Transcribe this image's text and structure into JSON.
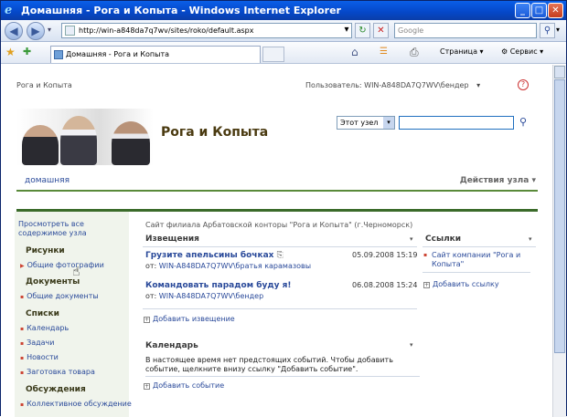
{
  "window": {
    "title": "Домашняя - Рога и Копыта - Windows Internet Explorer",
    "ie_glyph": "e",
    "min": "_",
    "max": "□",
    "close": "✕"
  },
  "nav": {
    "back_icon": "back-arrow-icon",
    "fwd_icon": "forward-arrow-icon",
    "address": "http://win-a848da7q7wv/sites/roko/default.aspx",
    "search_placeholder": "Google",
    "back_glyph": "◀",
    "fwd_glyph": "▶",
    "dropdown_glyph": "▾",
    "refresh_glyph": "↻",
    "stop_glyph": "✕",
    "search_glyph": "⚲"
  },
  "cmdbar": {
    "tab_label": "Домашняя - Рога и Копыта",
    "page_menu": "Страница",
    "service_menu": "Сервис",
    "home_glyph": "⌂",
    "feed_glyph": "☰",
    "print_glyph": "⎙",
    "fav_glyph": "★",
    "addfav_glyph": "✚"
  },
  "header": {
    "breadcrumb": "Рога и Копыта",
    "user_label": "Пользователь: WIN-A848DA7Q7WV\\бендер",
    "user_dropdown": "▾",
    "help_glyph": "?",
    "site_title": "Рога и Копыта",
    "scope": "Этот узел",
    "scope_arrow": "▾",
    "search_go": "⚲",
    "home_tab": "домашняя",
    "site_actions": "Действия узла ▾"
  },
  "quicklaunch": {
    "all_content": "Просмотреть все содержимое узла",
    "sections": [
      {
        "title": "Рисунки",
        "items": [
          "Общие фотографии"
        ]
      },
      {
        "title": "Документы",
        "items": [
          "Общие документы"
        ]
      },
      {
        "title": "Списки",
        "items": [
          "Календарь",
          "Задачи",
          "Новости",
          "Заготовка товара"
        ]
      },
      {
        "title": "Обсуждения",
        "items": [
          "Коллективное обсуждение"
        ]
      }
    ]
  },
  "main": {
    "description": "Сайт филиала Арбатовской конторы \"Рога и Копыта\" (г.Черноморск)",
    "announcements": {
      "title": "Извещения",
      "menu": "▾",
      "items": [
        {
          "title": "Грузите апельсины бочках",
          "attach": "⎘",
          "date": "05.09.2008 15:19",
          "by_label": "от:",
          "by": "WIN-A848DA7Q7WV\\братья карамазовы"
        },
        {
          "title": "Командовать парадом буду я!",
          "attach": "",
          "date": "06.08.2008 15:24",
          "by_label": "от:",
          "by": "WIN-A848DA7Q7WV\\бендер"
        }
      ],
      "add": "Добавить извещение"
    },
    "calendar": {
      "title": "Календарь",
      "menu": "▾",
      "text": "В настоящее время нет предстоящих событий. Чтобы добавить событие, щелкните внизу ссылку \"Добавить событие\".",
      "add": "Добавить событие"
    },
    "links": {
      "title": "Ссылки",
      "menu": "▾",
      "items": [
        "Сайт компании \"Рога и Копыта\""
      ],
      "add": "Добавить ссылку"
    }
  }
}
